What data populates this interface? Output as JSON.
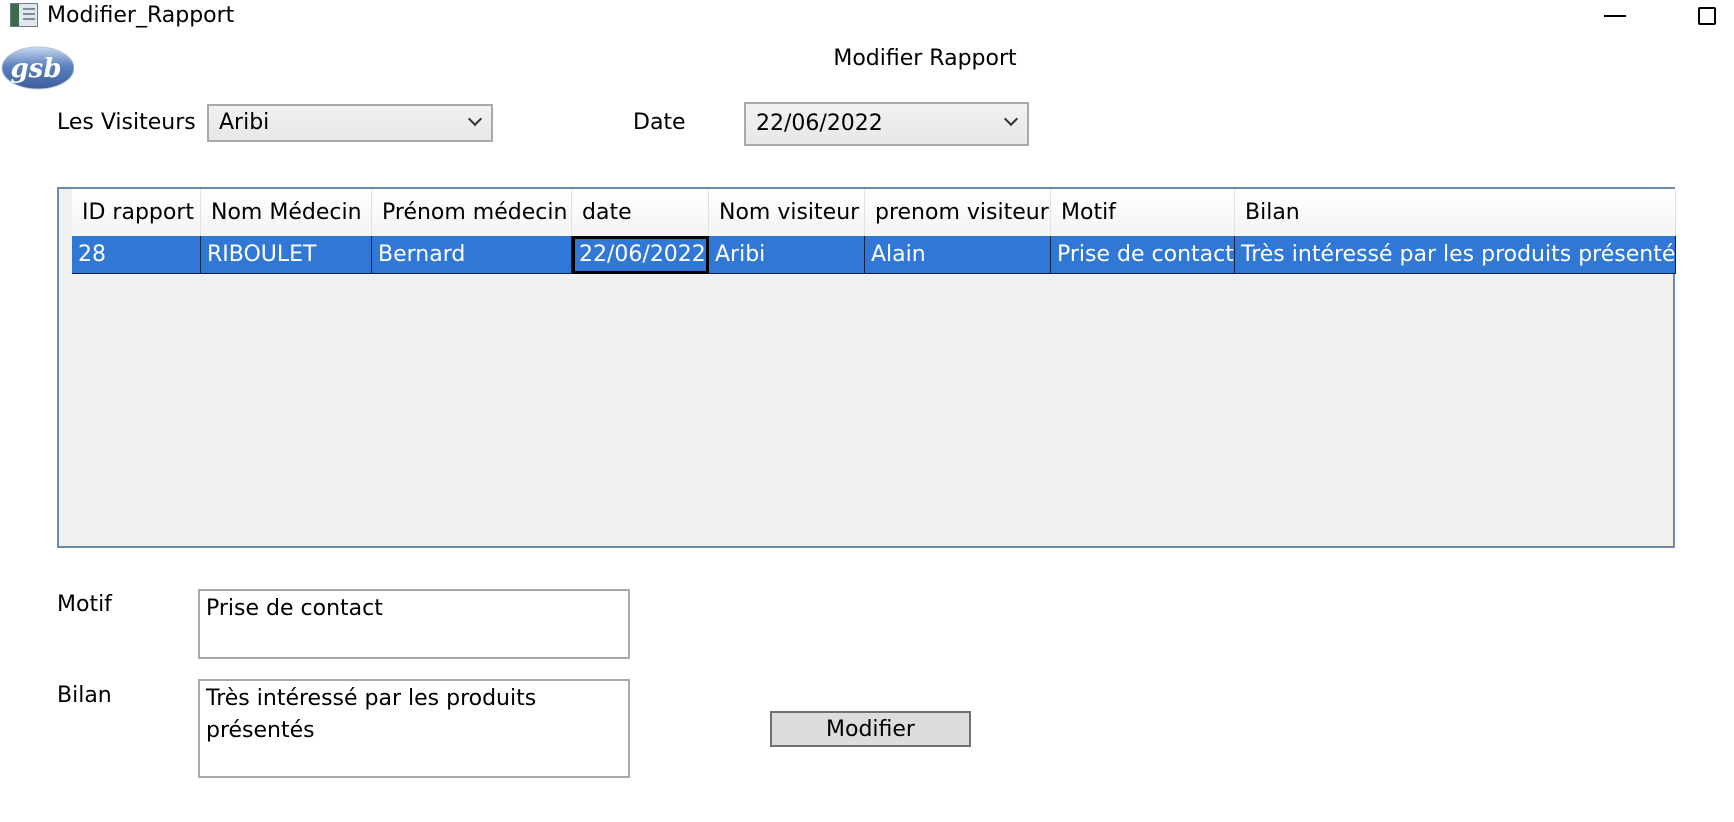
{
  "window": {
    "title": "Modifier_Rapport",
    "icon": "app-form-icon"
  },
  "logo": {
    "text": "gsb"
  },
  "page": {
    "heading": "Modifier Rapport"
  },
  "filters": {
    "visiteurs_label": "Les Visiteurs",
    "visiteurs_value": "Aribi",
    "date_label": "Date",
    "date_value": "22/06/2022"
  },
  "grid": {
    "columns": [
      "ID rapport",
      "Nom Médecin",
      "Prénom médecin",
      "date",
      "Nom visiteur",
      "prenom visiteur",
      "Motif",
      "Bilan"
    ],
    "rows": [
      [
        "28",
        "RIBOULET",
        "Bernard",
        "22/06/2022",
        "Aribi",
        "Alain",
        "Prise de contact",
        "Très intéressé par les produits présentés"
      ]
    ]
  },
  "form": {
    "motif_label": "Motif",
    "motif_value": "Prise de contact",
    "bilan_label": "Bilan",
    "bilan_value": "Très intéressé par les produits\nprésentés",
    "modifier_button": "Modifier"
  },
  "colors": {
    "selection": "#3178d6",
    "grid_border": "#6f8aa8",
    "grid_background": "#f0f0f0",
    "logo_blue": "#4f73b0"
  }
}
